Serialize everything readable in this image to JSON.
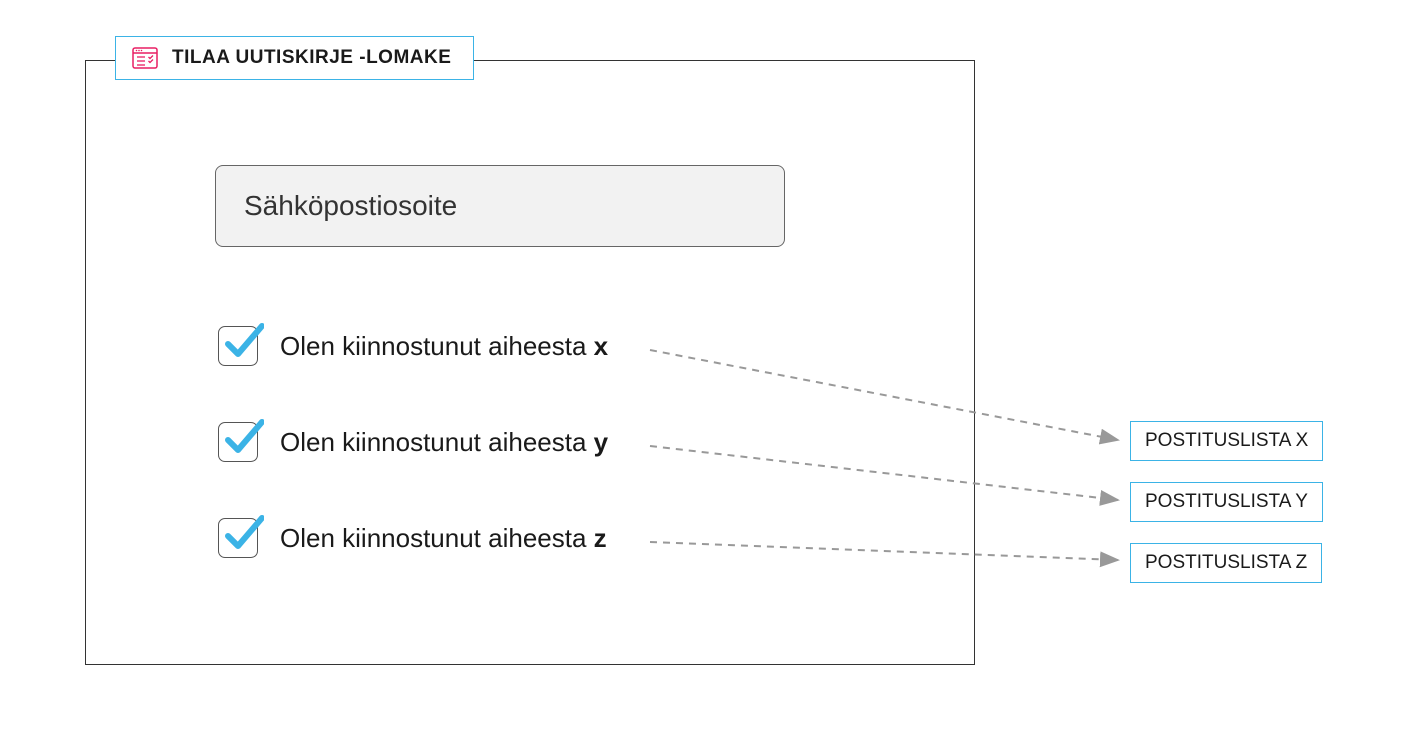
{
  "form": {
    "title": "TILAA UUTISKIRJE -LOMAKE",
    "email_placeholder": "Sähköpostiosoite",
    "checkboxes": [
      {
        "label_prefix": "Olen kiinnostunut aiheesta ",
        "label_bold": "x",
        "checked": true
      },
      {
        "label_prefix": "Olen kiinnostunut aiheesta ",
        "label_bold": "y",
        "checked": true
      },
      {
        "label_prefix": "Olen kiinnostunut aiheesta ",
        "label_bold": "z",
        "checked": true
      }
    ]
  },
  "mailing_lists": [
    "POSTITUSLISTA X",
    "POSTITUSLISTA Y",
    "POSTITUSLISTA Z"
  ],
  "colors": {
    "accent_blue": "#3bb3e6",
    "accent_pink": "#e91e63",
    "border_grey": "#888"
  }
}
